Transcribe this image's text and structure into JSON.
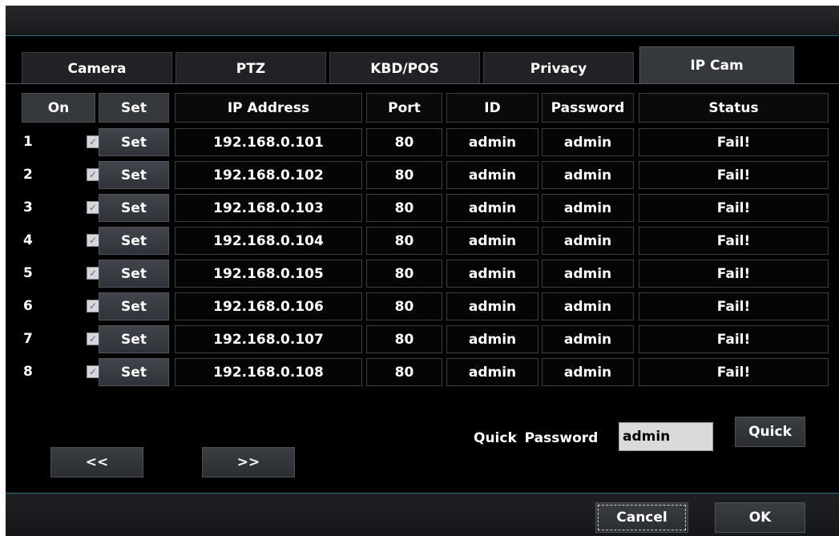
{
  "tabs": [
    "Camera",
    "PTZ",
    "KBD/POS",
    "Privacy",
    "IP Cam"
  ],
  "active_tab": "IP Cam",
  "columns": {
    "on": "On",
    "set": "Set",
    "ip": "IP Address",
    "port": "Port",
    "id": "ID",
    "password": "Password",
    "status": "Status"
  },
  "rows": [
    {
      "num": "1",
      "checked": true,
      "set": "Set",
      "ip": "192.168.0.101",
      "port": "80",
      "id": "admin",
      "password": "admin",
      "status": "Fail!"
    },
    {
      "num": "2",
      "checked": true,
      "set": "Set",
      "ip": "192.168.0.102",
      "port": "80",
      "id": "admin",
      "password": "admin",
      "status": "Fail!"
    },
    {
      "num": "3",
      "checked": true,
      "set": "Set",
      "ip": "192.168.0.103",
      "port": "80",
      "id": "admin",
      "password": "admin",
      "status": "Fail!"
    },
    {
      "num": "4",
      "checked": true,
      "set": "Set",
      "ip": "192.168.0.104",
      "port": "80",
      "id": "admin",
      "password": "admin",
      "status": "Fail!"
    },
    {
      "num": "5",
      "checked": true,
      "set": "Set",
      "ip": "192.168.0.105",
      "port": "80",
      "id": "admin",
      "password": "admin",
      "status": "Fail!"
    },
    {
      "num": "6",
      "checked": true,
      "set": "Set",
      "ip": "192.168.0.106",
      "port": "80",
      "id": "admin",
      "password": "admin",
      "status": "Fail!"
    },
    {
      "num": "7",
      "checked": true,
      "set": "Set",
      "ip": "192.168.0.107",
      "port": "80",
      "id": "admin",
      "password": "admin",
      "status": "Fail!"
    },
    {
      "num": "8",
      "checked": true,
      "set": "Set",
      "ip": "192.168.0.108",
      "port": "80",
      "id": "admin",
      "password": "admin",
      "status": "Fail!"
    }
  ],
  "quick": {
    "label": "Quick Password",
    "value": "admin",
    "button": "Quick"
  },
  "paging": {
    "prev": "<<",
    "next": ">>"
  },
  "footer": {
    "cancel": "Cancel",
    "ok": "OK"
  },
  "icons": {
    "checkbox": "check-icon"
  },
  "colors": {
    "background": "#000000",
    "panel": "#35383d",
    "accent_line": "#2f6f82",
    "text": "#ffffff"
  }
}
